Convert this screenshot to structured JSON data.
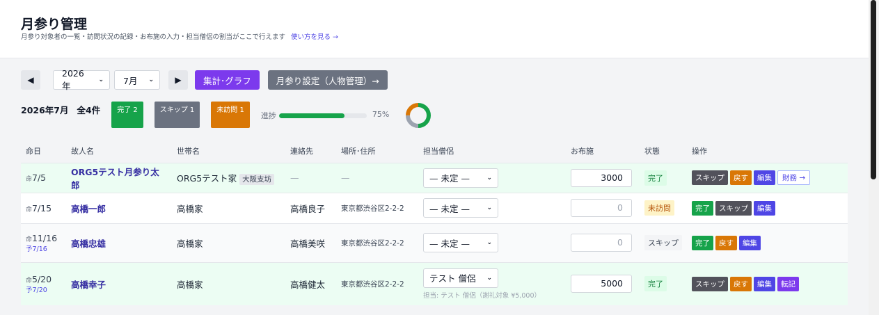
{
  "header": {
    "title": "月参り管理",
    "subtitle": "月参り対象者の一覧・訪問状況の記録・お布施の入力・担当僧侶の割当がここで行えます",
    "help_link": "使い方を見る →"
  },
  "controls": {
    "prev": "◀",
    "year": "2026年",
    "month": "7月",
    "next": "▶",
    "stats_button": "集計･グラフ",
    "settings_button": "月参り設定（人物管理）→"
  },
  "summary": {
    "month_label": "2026年7月",
    "total_label": "全4件",
    "done_label": "完了 2",
    "skip_label": "スキップ 1",
    "todo_label": "未訪問 1",
    "progress_label": "進捗",
    "progress_percent": 75,
    "progress_text": "75%",
    "colors": {
      "done": "#16a34a",
      "skip": "#9ca3af",
      "todo": "#d97706"
    }
  },
  "table": {
    "headers": [
      "命日",
      "故人名",
      "世帯名",
      "連絡先",
      "場所･住所",
      "担当僧侶",
      "お布施",
      "状態",
      "操作"
    ],
    "rows": [
      {
        "date": "7/5",
        "date_sub": "",
        "name": "ORG5テスト月参り太郎",
        "household": "ORG5テスト家",
        "household_tag": "大阪支坊",
        "contact": "—",
        "address": "—",
        "monk": "— 未定 —",
        "monk_note": "",
        "amount": "3000",
        "status": "完了",
        "actions": [
          "スキップ",
          "戻す",
          "編集",
          "財務 →"
        ]
      },
      {
        "date": "7/15",
        "date_sub": "",
        "name": "高橋一郎",
        "household": "高橋家",
        "household_tag": "",
        "contact": "高橋良子",
        "address": "東京都渋谷区2-2-2",
        "monk": "— 未定 —",
        "monk_note": "",
        "amount": "0",
        "status": "未訪問",
        "actions": [
          "完了",
          "スキップ",
          "編集"
        ]
      },
      {
        "date": "11/16",
        "date_sub": "予7/16",
        "name": "高橋忠雄",
        "household": "高橋家",
        "household_tag": "",
        "contact": "高橋美咲",
        "address": "東京都渋谷区2-2-2",
        "monk": "— 未定 —",
        "monk_note": "",
        "amount": "0",
        "status": "スキップ",
        "actions": [
          "完了",
          "戻す",
          "編集"
        ]
      },
      {
        "date": "5/20",
        "date_sub": "予7/20",
        "name": "高橋幸子",
        "household": "高橋家",
        "household_tag": "",
        "contact": "高橋健太",
        "address": "東京都渋谷区2-2-2",
        "monk": "テスト 僧侶",
        "monk_note": "担当: テスト 僧侶（謝礼対象 ¥5,000）",
        "amount": "5000",
        "status": "完了",
        "actions": [
          "スキップ",
          "戻す",
          "編集",
          "転記"
        ]
      }
    ]
  }
}
